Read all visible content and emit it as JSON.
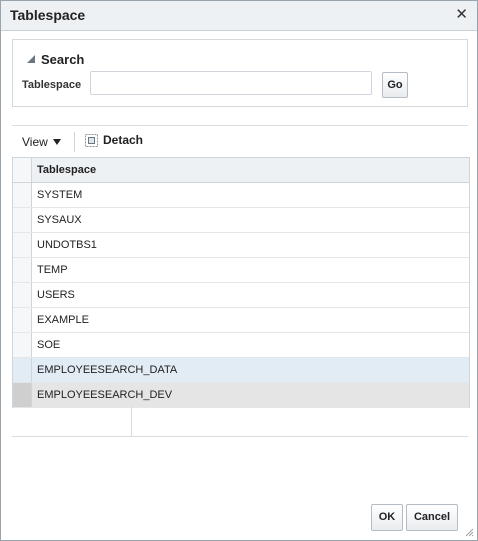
{
  "dialog": {
    "title": "Tablespace",
    "close_glyph": "✕"
  },
  "search": {
    "heading": "Search",
    "field_label": "Tablespace",
    "input_value": "",
    "go_label": "Go"
  },
  "toolbar": {
    "view_label": "View",
    "detach_label": "Detach"
  },
  "table": {
    "column_header": "Tablespace",
    "rows": [
      "SYSTEM",
      "SYSAUX",
      "UNDOTBS1",
      "TEMP",
      "USERS",
      "EXAMPLE",
      "SOE",
      "EMPLOYEESEARCH_DATA",
      "EMPLOYEESEARCH_DEV"
    ]
  },
  "footer": {
    "ok_label": "OK",
    "cancel_label": "Cancel"
  },
  "icons": {
    "close": "close-icon",
    "collapse": "collapse-triangle-icon",
    "view_caret": "caret-down-icon",
    "detach": "detach-icon",
    "resize": "resize-grip-icon"
  }
}
